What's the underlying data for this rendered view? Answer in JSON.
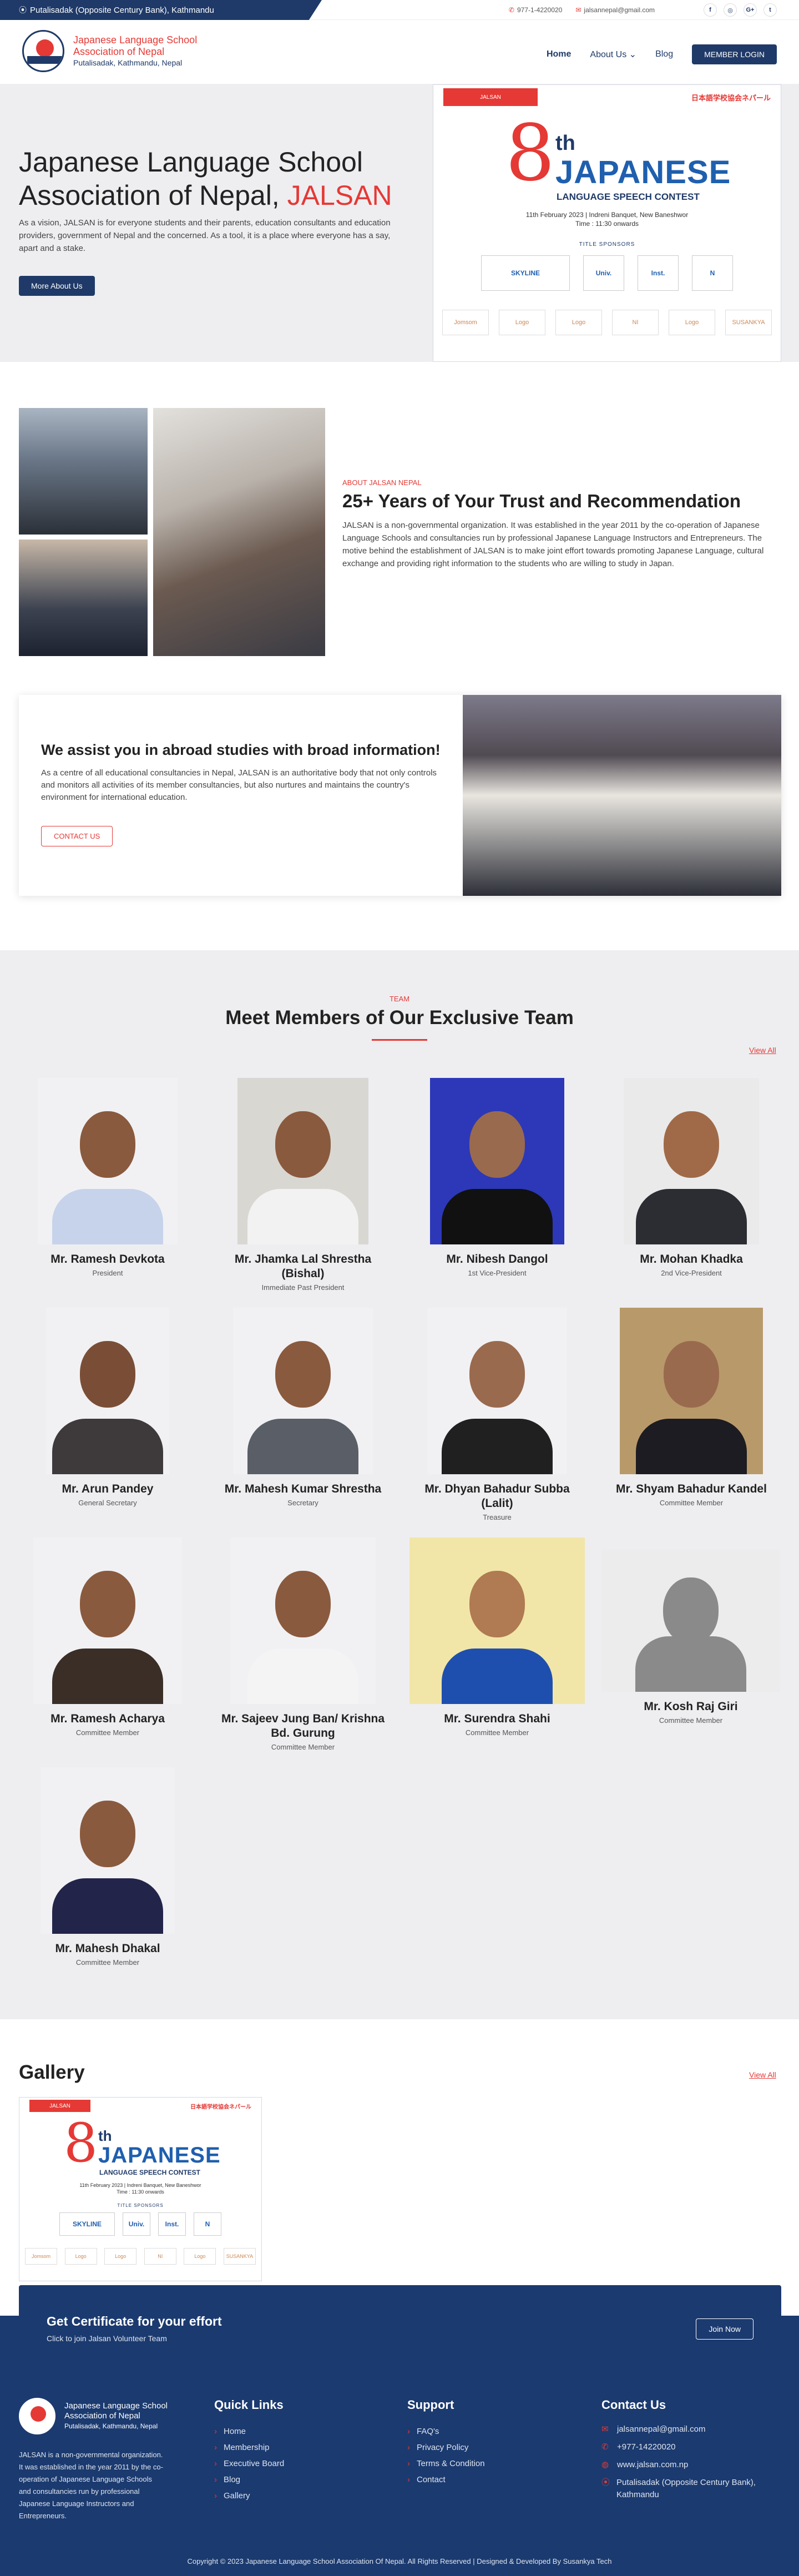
{
  "topbar": {
    "address": "Putalisadak (Opposite Century Bank), Kathmandu",
    "phone": "977-1-4220020",
    "email": "jalsannepal@gmail.com",
    "social_icons": [
      "facebook-icon",
      "instagram-icon",
      "google-plus-icon",
      "twitter-icon"
    ],
    "social_glyphs": [
      "f",
      "◎",
      "G+",
      "t"
    ]
  },
  "header": {
    "logo_line1": "Japanese Language School",
    "logo_line2": "Association of Nepal",
    "logo_line3": "Putalisadak, Kathmandu, Nepal",
    "nav": [
      "Home",
      "About Us",
      "Blog"
    ],
    "login": "MEMBER LOGIN"
  },
  "hero": {
    "title_line1": "Japanese Language School",
    "title_line2": "Association of Nepal,",
    "title_highlight": "JALSAN",
    "description": "As a vision, JALSAN is for everyone students and their parents, education consultants and education providers, government of Nepal and the concerned. As a tool, it is a place where everyone has a say, apart and a stake.",
    "button": "More About Us"
  },
  "poster": {
    "top_right": "日本語学校協会ネパール",
    "number": "8",
    "ordinal": "th",
    "title": "JAPANESE",
    "subtitle": "LANGUAGE SPEECH CONTEST",
    "date": "11th February 2023 | Indreni Banquet, New Baneshwor",
    "time": "Time : 11:30 onwards",
    "sponsor_label": "TITLE SPONSORS",
    "sponsors": [
      "SKYLINE",
      "Univ.",
      "Inst.",
      "N"
    ],
    "bottom": [
      "Jomsom",
      "Logo",
      "Logo",
      "NI",
      "Logo",
      "SUSANKYA"
    ]
  },
  "about": {
    "kicker": "ABOUT JALSAN NEPAL",
    "title": "25+ Years of Your Trust and Recommendation",
    "text": "JALSAN is a non-governmental organization. It was established in the year 2011 by the co-operation of Japanese Language Schools and consultancies run by professional Japanese Language Instructors and Entrepreneurs. The motive behind the establishment of JALSAN is to make joint effort towards promoting Japanese Language, cultural exchange and providing right information to the students who are willing to study in Japan."
  },
  "assist": {
    "title": "We assist you in abroad studies with broad information!",
    "text": "As a centre of all educational consultancies in Nepal, JALSAN is an authoritative body that not only controls and monitors all activities of its member consultancies, but also nurtures and maintains the country's environment for international education.",
    "button": "CONTACT US"
  },
  "team": {
    "kicker": "TEAM",
    "title": "Meet Members of Our Exclusive Team",
    "view_all": "View All",
    "members": [
      {
        "name": "Mr. Ramesh Devkota",
        "role": "President"
      },
      {
        "name": "Mr. Jhamka Lal Shrestha (Bishal)",
        "role": "Immediate Past President"
      },
      {
        "name": "Mr. Nibesh Dangol",
        "role": "1st Vice-President"
      },
      {
        "name": "Mr. Mohan Khadka",
        "role": "2nd Vice-President"
      },
      {
        "name": "Mr. Arun Pandey",
        "role": "General Secretary"
      },
      {
        "name": "Mr. Mahesh Kumar Shrestha",
        "role": "Secretary"
      },
      {
        "name": "Mr. Dhyan Bahadur Subba (Lalit)",
        "role": "Treasure"
      },
      {
        "name": "Mr. Shyam Bahadur Kandel",
        "role": "Committee Member"
      },
      {
        "name": "Mr. Ramesh Acharya",
        "role": "Committee Member"
      },
      {
        "name": "Mr. Sajeev Jung Ban/ Krishna Bd. Gurung",
        "role": "Committee Member"
      },
      {
        "name": "Mr. Surendra Shahi",
        "role": "Committee Member"
      },
      {
        "name": "Mr. Kosh Raj Giri",
        "role": "Committee Member"
      },
      {
        "name": "Mr. Mahesh Dhakal",
        "role": "Committee Member"
      }
    ]
  },
  "gallery": {
    "title": "Gallery",
    "view_all": "View All"
  },
  "cta": {
    "title": "Get Certificate for your effort",
    "subtitle": "Click to join Jalsan Volunteer Team",
    "button": "Join Now"
  },
  "footer": {
    "logo_line1": "Japanese Language School",
    "logo_line2": "Association of Nepal",
    "logo_line3": "Putalisadak, Kathmandu, Nepal",
    "about": "JALSAN is a non-governmental organization. It was established in the year 2011 by the co-operation of Japanese Language Schools and consultancies run by professional Japanese Language Instructors and Entrepreneurs.",
    "quick_links_title": "Quick Links",
    "quick_links": [
      "Home",
      "Membership",
      "Executive Board",
      "Blog",
      "Gallery"
    ],
    "support_title": "Support",
    "support_links": [
      "FAQ's",
      "Privacy Policy",
      "Terms & Condition",
      "Contact"
    ],
    "contact_title": "Contact Us",
    "contact_email": "jalsannepal@gmail.com",
    "contact_phone": "+977-14220020",
    "contact_web": "www.jalsan.com.np",
    "contact_address": "Putalisadak (Opposite Century Bank), Kathmandu",
    "copyright": "Copyright © 2023 Japanese Language School Association Of Nepal. All Rights Reserved | Designed & Developed By Susankya Tech"
  },
  "colors": {
    "brand": "#1f3a68",
    "accent": "#e53935"
  }
}
